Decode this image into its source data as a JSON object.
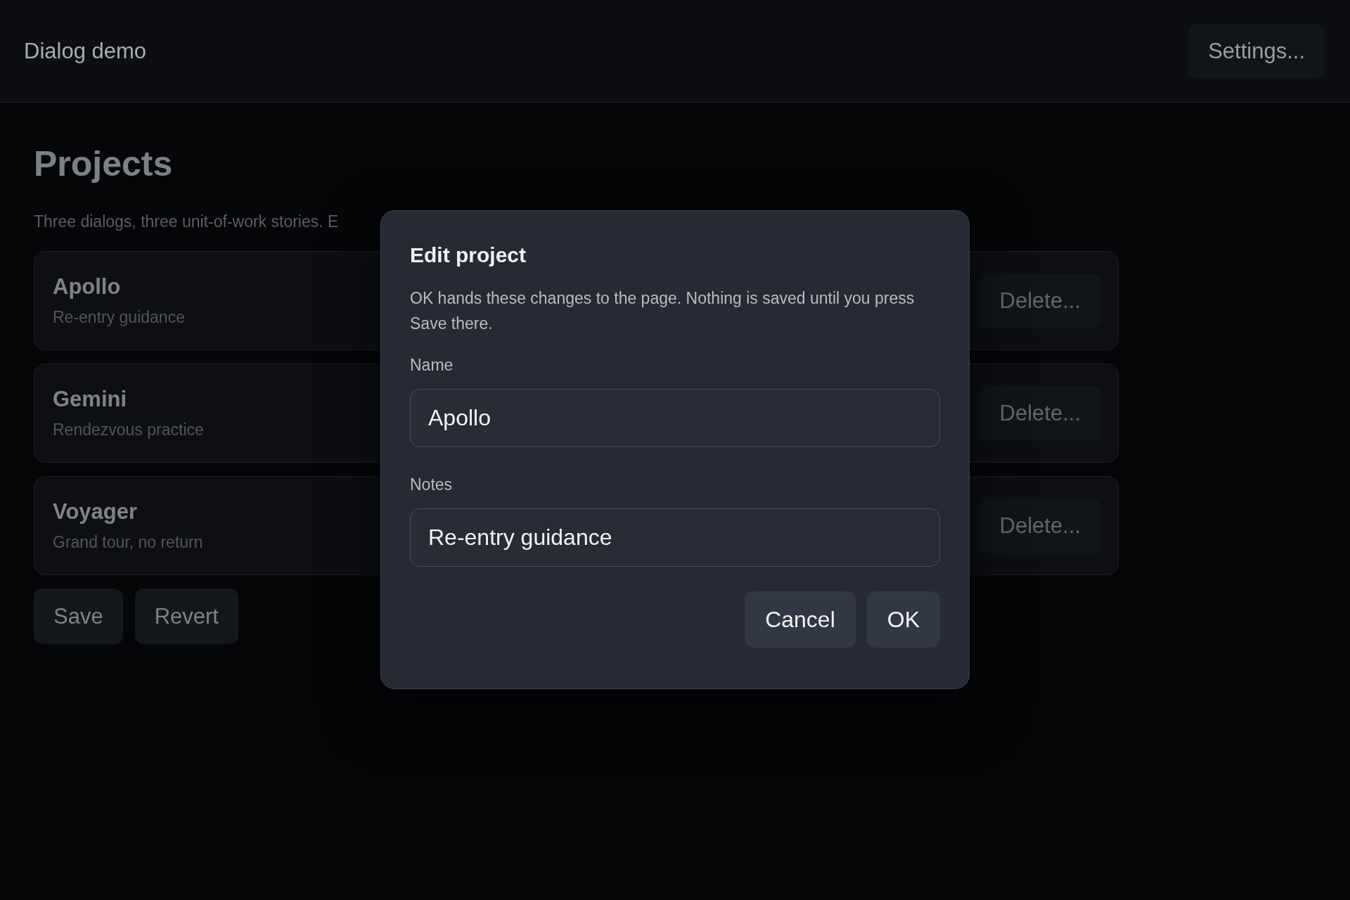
{
  "header": {
    "title": "Dialog demo",
    "settings_button": "Settings..."
  },
  "page": {
    "heading": "Projects",
    "intro": "Three dialogs, three unit-of-work stories. E"
  },
  "projects": [
    {
      "name": "Apollo",
      "notes": "Re-entry guidance",
      "delete_button": "Delete..."
    },
    {
      "name": "Gemini",
      "notes": "Rendezvous practice",
      "delete_button": "Delete..."
    },
    {
      "name": "Voyager",
      "notes": "Grand tour, no return",
      "delete_button": "Delete..."
    }
  ],
  "actions": [
    "Save",
    "Revert"
  ],
  "dialog": {
    "title": "Edit project",
    "description": "OK hands these changes to the page. Nothing is saved until you press Save there.",
    "fields": [
      {
        "label": "Name",
        "value": "Apollo"
      },
      {
        "label": "Notes",
        "value": "Re-entry guidance"
      }
    ],
    "buttons": [
      "Cancel",
      "OK"
    ]
  }
}
